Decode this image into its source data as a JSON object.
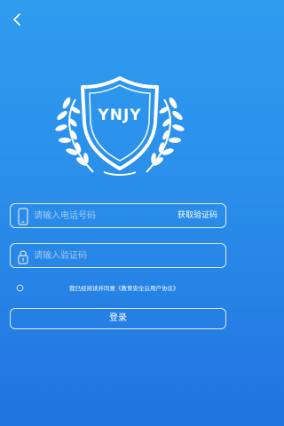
{
  "header": {
    "back_icon": "chevron-left-icon"
  },
  "logo": {
    "text": "YNJY"
  },
  "phone": {
    "icon": "phone-icon",
    "placeholder": "请输入电话号码",
    "value": "",
    "get_code_label": "获取验证码"
  },
  "code": {
    "icon": "lock-icon",
    "placeholder": "请输入验证码",
    "value": ""
  },
  "agreement": {
    "checked": false,
    "prefix": "我已经阅读并同意",
    "link_text": "《教育安全云用户协议》"
  },
  "login": {
    "label": "登录"
  },
  "colors": {
    "background_top": "#2f9cf0",
    "background_bottom": "#2173e0",
    "foreground": "#ffffff"
  }
}
